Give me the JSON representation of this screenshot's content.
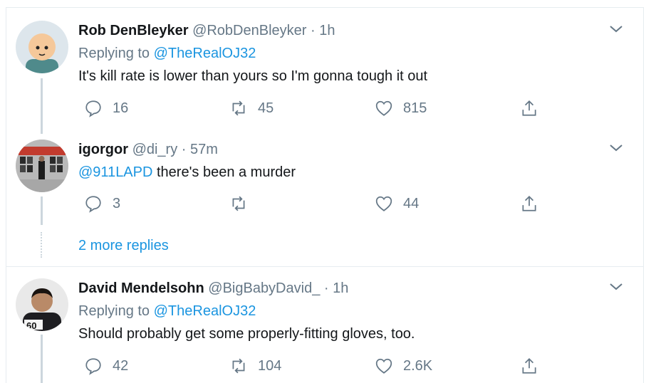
{
  "tweets": [
    {
      "name": "Rob DenBleyker",
      "handle": "@RobDenBleyker",
      "dot": "·",
      "time": "1h",
      "replying_prefix": "Replying to",
      "replying_to": "@TheRealOJ32",
      "text": "It's kill rate is lower than yours so I'm gonna tough it out",
      "replies": "16",
      "retweets": "45",
      "likes": "815"
    },
    {
      "name": "igorgor",
      "handle": "@di_ry",
      "dot": "·",
      "time": "57m",
      "mention": "@911LAPD",
      "text": " there's been a murder",
      "replies": "3",
      "retweets": "",
      "likes": "44"
    },
    {
      "name": "David Mendelsohn",
      "handle": "@BigBabyDavid_",
      "dot": "·",
      "time": "1h",
      "replying_prefix": "Replying to",
      "replying_to": "@TheRealOJ32",
      "text": "Should probably get some properly-fitting gloves, too.",
      "replies": "42",
      "retweets": "104",
      "likes": "2.6K"
    }
  ],
  "more_replies": "2 more replies",
  "colors": {
    "link": "#1b95e0",
    "muted": "#657786",
    "text": "#14171a",
    "line": "#ccd6dd"
  },
  "icons": [
    "reply-icon",
    "retweet-icon",
    "like-icon",
    "share-icon",
    "chevron-down-icon"
  ]
}
